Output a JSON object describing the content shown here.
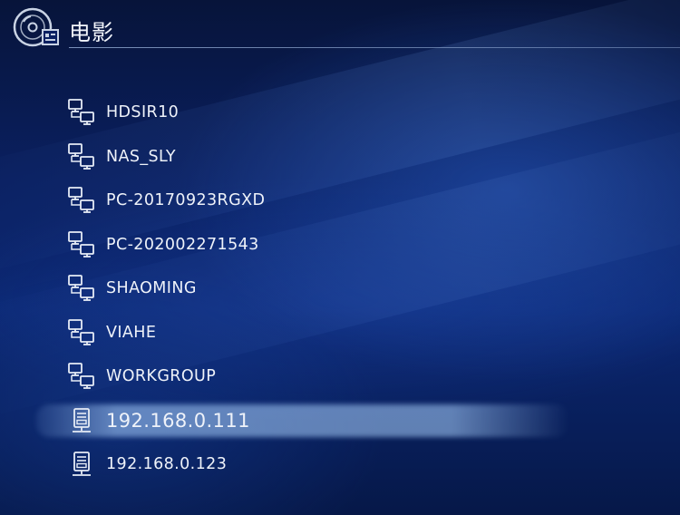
{
  "header": {
    "title": "电影",
    "icon": "disc-folder-icon"
  },
  "colors": {
    "background": "#0a2061",
    "highlight": "#aad2ff",
    "text": "#eef2f9"
  },
  "items": [
    {
      "label": "HDSIR10",
      "icon": "workgroup-network-icon"
    },
    {
      "label": "NAS_SLY",
      "icon": "workgroup-network-icon"
    },
    {
      "label": "PC-20170923RGXD",
      "icon": "workgroup-network-icon"
    },
    {
      "label": "PC-202002271543",
      "icon": "workgroup-network-icon"
    },
    {
      "label": "SHAOMING",
      "icon": "workgroup-network-icon"
    },
    {
      "label": "VIAHE",
      "icon": "workgroup-network-icon"
    },
    {
      "label": "WORKGROUP",
      "icon": "workgroup-network-icon"
    },
    {
      "label": "192.168.0.111",
      "icon": "server-icon",
      "selected": true
    },
    {
      "label": "192.168.0.123",
      "icon": "server-icon"
    }
  ]
}
